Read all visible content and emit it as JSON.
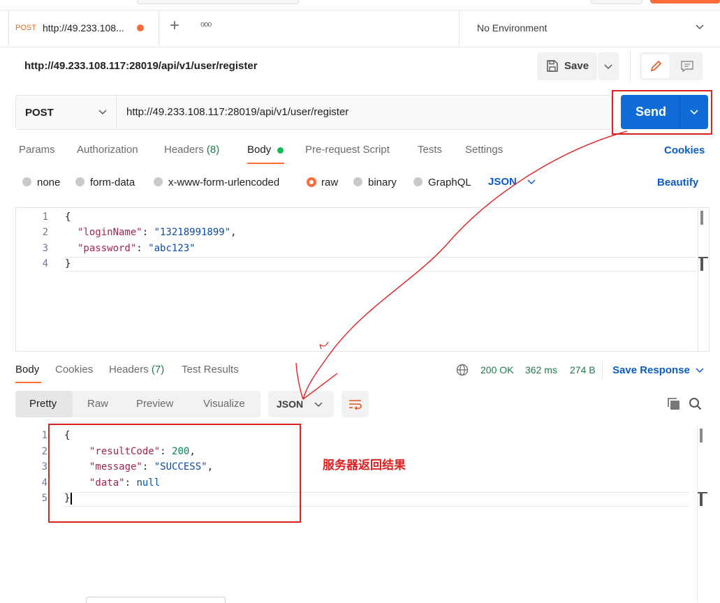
{
  "tab": {
    "method": "POST",
    "title": "http://49.233.108...",
    "add": "+",
    "more": "ooo"
  },
  "environment": {
    "label": "No Environment"
  },
  "request": {
    "url_title": "http://49.233.108.117:28019/api/v1/user/register",
    "save_label": "Save",
    "method": "POST",
    "url": "http://49.233.108.117:28019/api/v1/user/register",
    "send_label": "Send"
  },
  "request_tabs": [
    "Params",
    "Authorization",
    "Headers",
    "(8)",
    "Body",
    "Pre-request Script",
    "Tests",
    "Settings"
  ],
  "cookies_label": "Cookies",
  "body_types": [
    "none",
    "form-data",
    "x-www-form-urlencoded",
    "raw",
    "binary",
    "GraphQL"
  ],
  "body_format": "JSON",
  "beautify_label": "Beautify",
  "request_body": {
    "line_numbers": [
      "1",
      "2",
      "3",
      "4"
    ],
    "open": "{",
    "key1": "\"loginName\"",
    "val1": "\"13218991899\"",
    "key2": "\"password\"",
    "val2": "\"abc123\"",
    "close": "}"
  },
  "response_tabs": [
    "Body",
    "Cookies",
    "Headers",
    "(7)",
    "Test Results"
  ],
  "status": {
    "code": "200 OK",
    "time": "362 ms",
    "size": "274 B"
  },
  "save_response_label": "Save Response",
  "view_tabs": [
    "Pretty",
    "Raw",
    "Preview",
    "Visualize"
  ],
  "response_format": "JSON",
  "response_body": {
    "line_numbers": [
      "1",
      "2",
      "3",
      "4",
      "5"
    ],
    "open": "{",
    "key1": "\"resultCode\"",
    "val1": "200",
    "key2": "\"message\"",
    "val2": "\"SUCCESS\"",
    "key3": "\"data\"",
    "val3": "null",
    "close": "}"
  },
  "annotation": "服务器返回结果",
  "colors": {
    "accent": "#ff6c37",
    "send": "#0f6bd6",
    "link": "#0a5bc4",
    "status": "#1f7a4a",
    "annotation": "#dd2020"
  }
}
